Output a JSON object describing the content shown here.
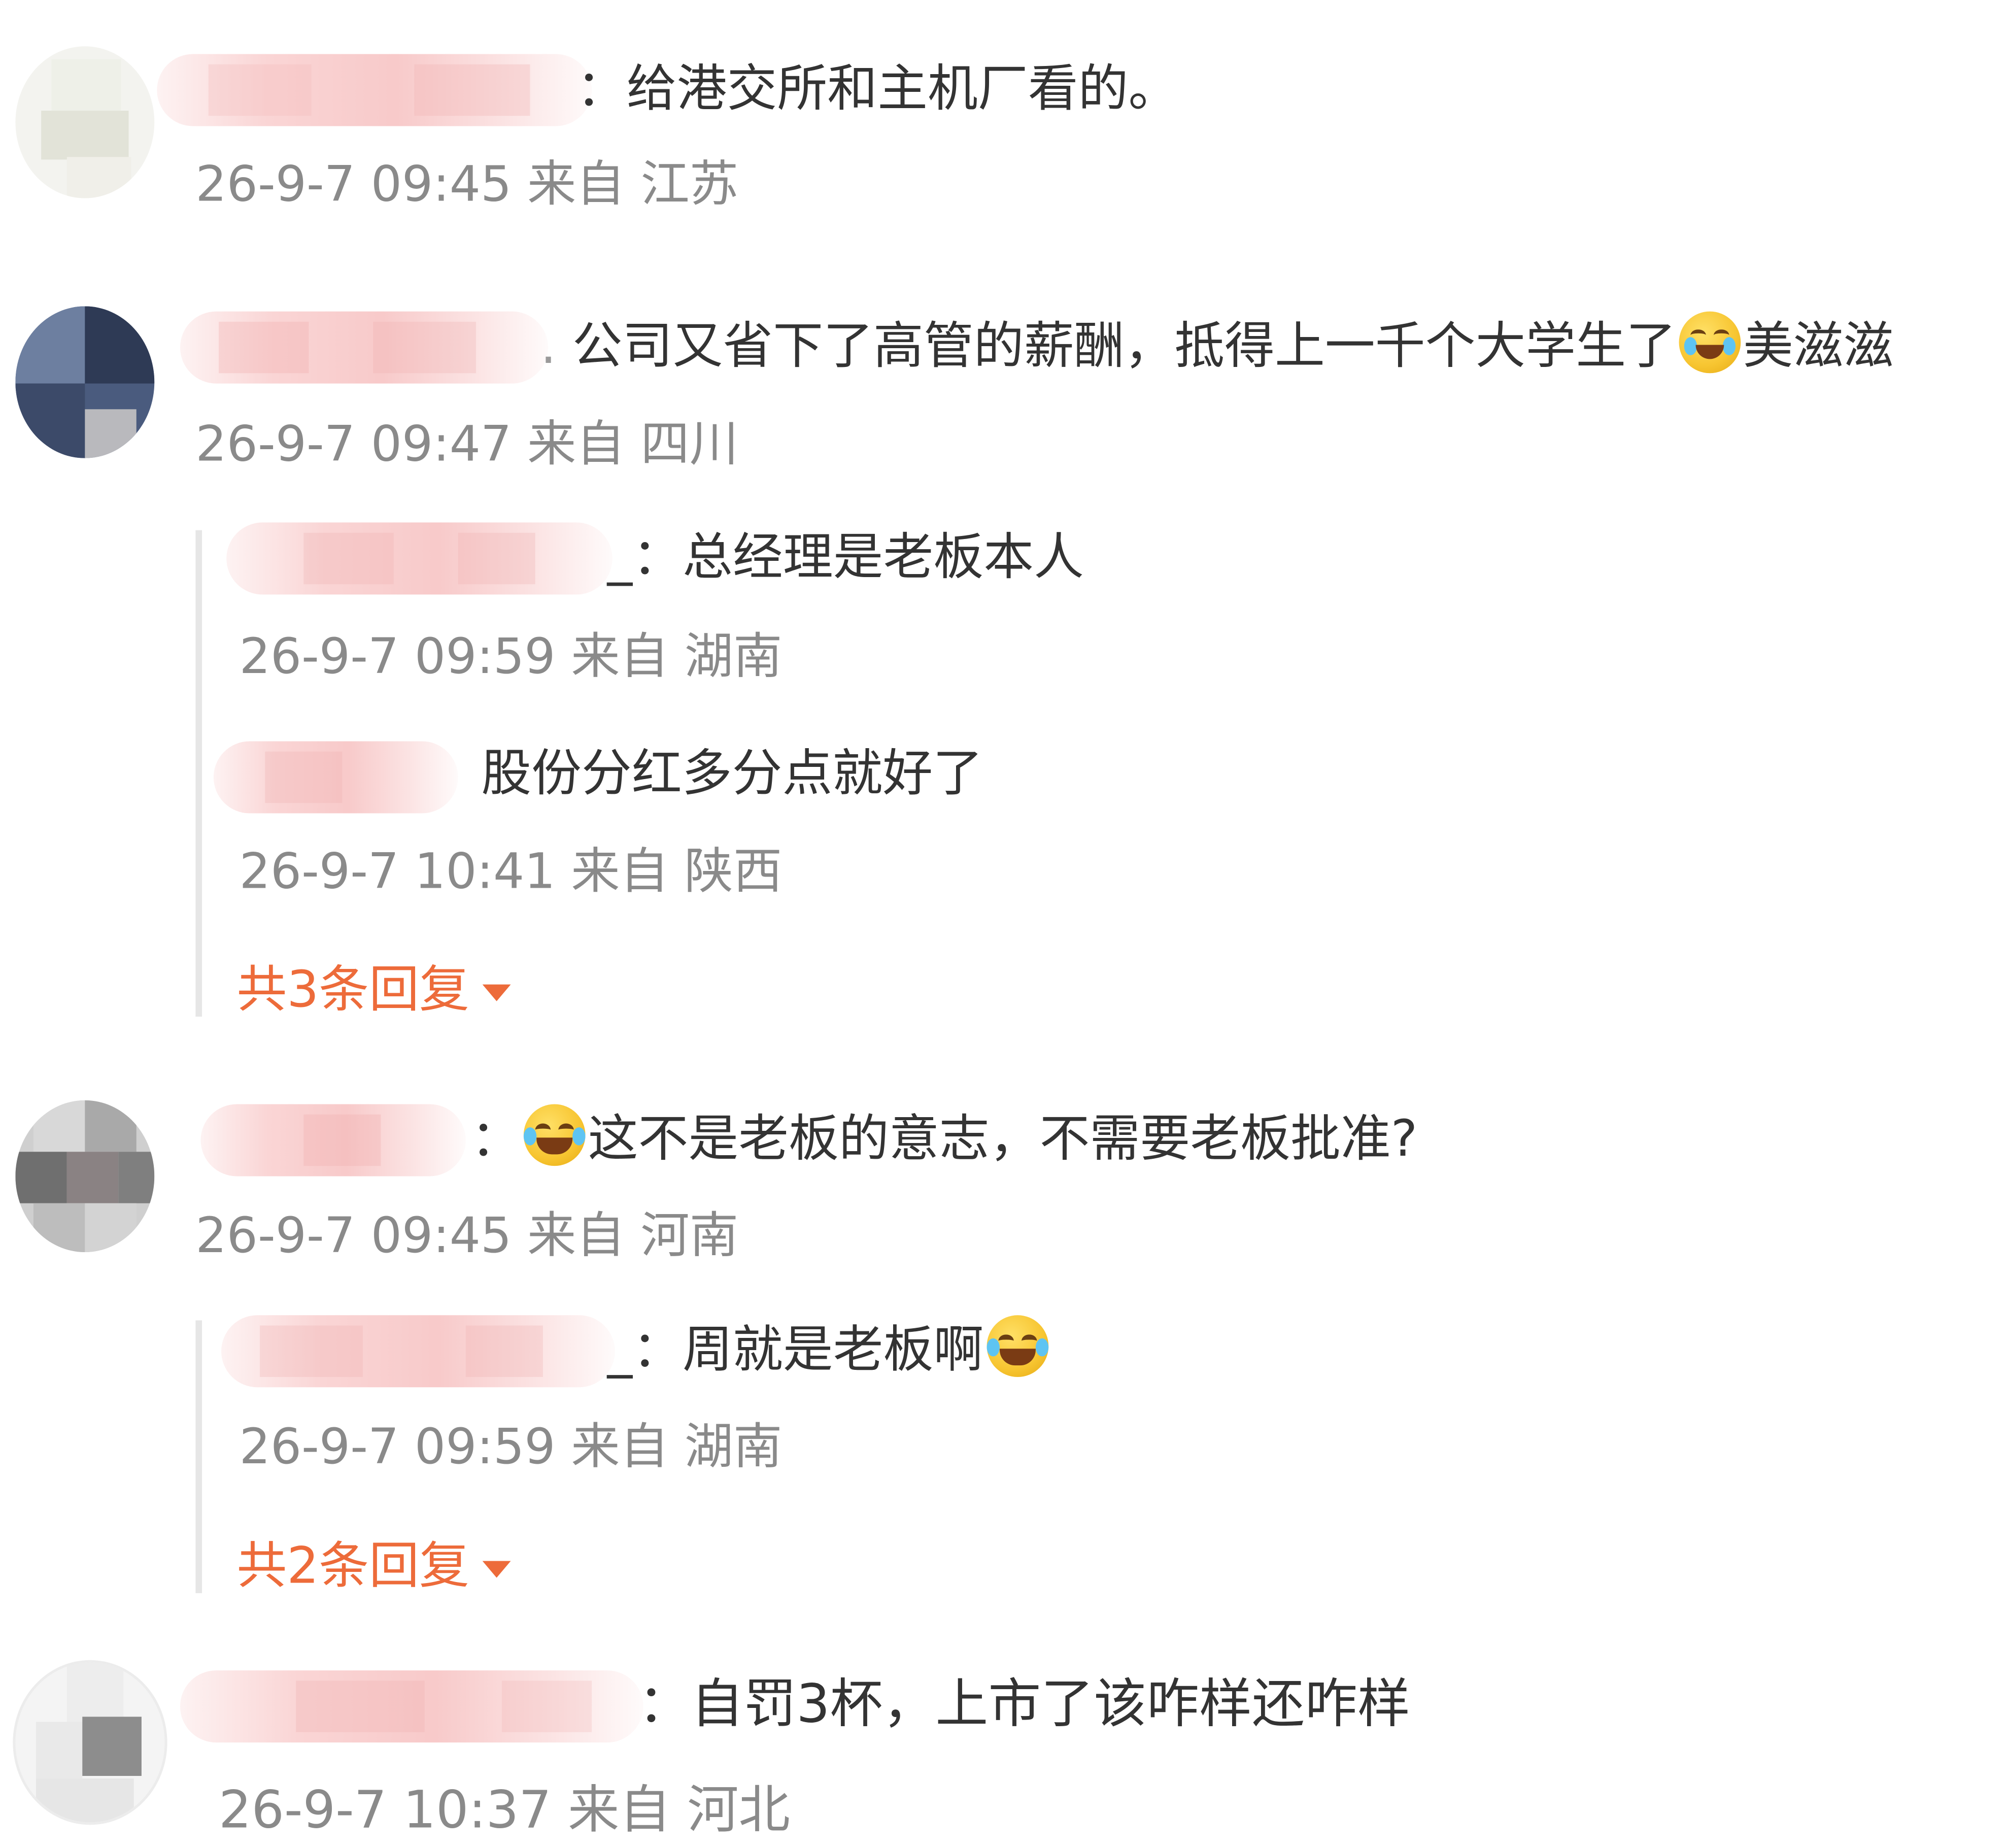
{
  "comments": [
    {
      "text": "：给港交所和主机厂看的。",
      "time": "26-9-7 09:45",
      "from_label": "来自",
      "location": "江苏"
    },
    {
      "text": "公司又省下了高管的薪酬，抵得上一千个大学生了",
      "emoji": "crying-emoji",
      "text_after_emoji": "美滋滋",
      "time": "26-9-7 09:47",
      "from_label": "来自",
      "location": "四川",
      "replies": [
        {
          "text": "_：总经理是老板本人",
          "time": "26-9-7 09:59",
          "from_label": "来自",
          "location": "湖南"
        },
        {
          "text": "股份分红多分点就好了",
          "time": "26-9-7 10:41",
          "from_label": "来自",
          "location": "陕西"
        }
      ],
      "more_replies": "共3条回复"
    },
    {
      "text_prefix": "：",
      "emoji": "laugh-cry-emoji",
      "text": "这不是老板的意志，不需要老板批准?",
      "time": "26-9-7 09:45",
      "from_label": "来自",
      "location": "河南",
      "replies": [
        {
          "text": "_：周就是老板啊",
          "emoji": "laugh-cry-emoji",
          "time": "26-9-7 09:59",
          "from_label": "来自",
          "location": "湖南"
        }
      ],
      "more_replies": "共2条回复"
    },
    {
      "text": "：自罚3杯，上市了该咋样还咋样",
      "time": "26-9-7 10:37",
      "from_label": "来自",
      "location": "河北"
    }
  ],
  "colors": {
    "text": "#333333",
    "meta": "#8a8a8a",
    "accent": "#ed6b3a",
    "thread_line": "#e6e6e6"
  }
}
